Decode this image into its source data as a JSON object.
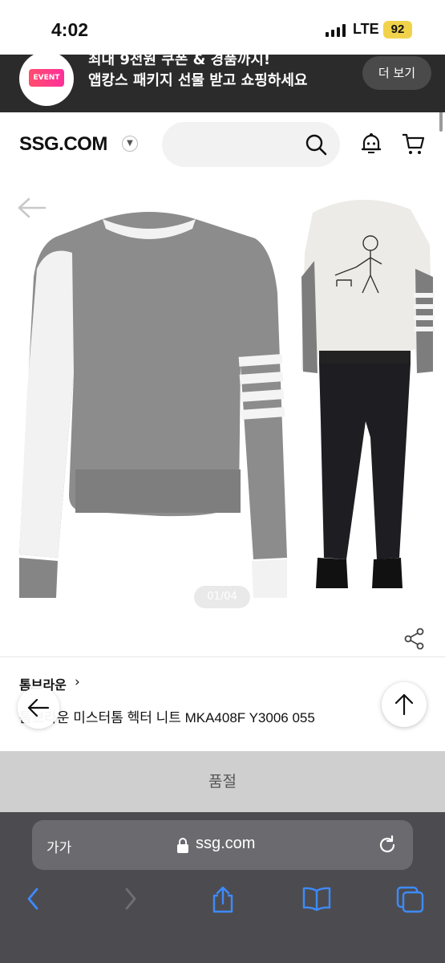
{
  "status_bar": {
    "time": "4:02",
    "network": "LTE",
    "battery": "92"
  },
  "banner": {
    "badge": "EVENT",
    "line1": "최대 9천원 쿠폰 & 경품까지!",
    "line2": "앱캉스 패키지 선물 받고 쇼핑하세요",
    "more_button": "더 보기"
  },
  "header": {
    "logo": "SSG.COM",
    "search_placeholder": ""
  },
  "gallery": {
    "page_indicator": "01/04"
  },
  "product": {
    "brand": "톰브라운",
    "name": "톰브라운 미스터톰 헥터 니트 MKA408F Y3006 055",
    "status": "품절"
  },
  "browser": {
    "text_size": "가가",
    "url": "ssg.com"
  },
  "colors": {
    "banner_bg": "#2b2b2b",
    "battery": "#f1d34b",
    "safari_bar": "#4c4c50",
    "accent_blue": "#3d8bff"
  }
}
